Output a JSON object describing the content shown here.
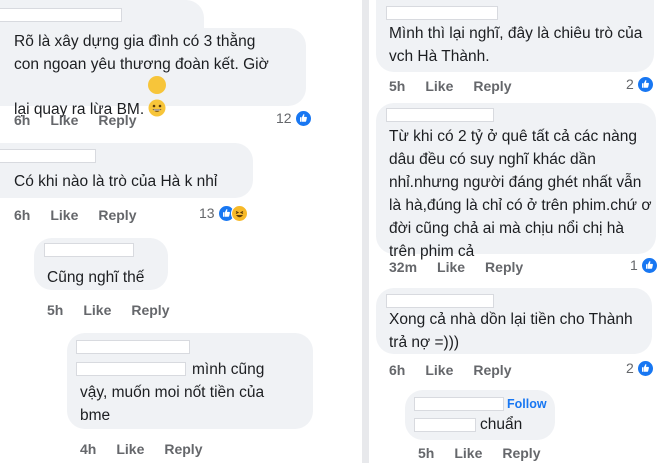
{
  "colors": {
    "bubble": "#f0f2f5",
    "meta_text": "#65676b",
    "like_blue": "#1877f2",
    "haha_yellow": "#f7b928",
    "divider": "#e8e9ec"
  },
  "left": {
    "c1": {
      "text": "Rõ là xây dựng gia đình có 3 thằng\ncon ngoan yêu thương đoàn kết. Giờ\nlại quay ra lừa BM.",
      "time": "6h",
      "like": "Like",
      "reply": "Reply",
      "count": "12",
      "emoji": "grinning-face-icon",
      "reactions": [
        "like-icon"
      ]
    },
    "c2": {
      "text": "Có khi nào là trò của Hà k nhỉ",
      "time": "6h",
      "like": "Like",
      "reply": "Reply",
      "count": "13",
      "reactions": [
        "like-icon",
        "haha-icon"
      ]
    },
    "c3": {
      "text": "Cũng nghĩ thế",
      "time": "5h",
      "like": "Like",
      "reply": "Reply"
    },
    "c4": {
      "text_first": "mình cũng",
      "text_rest": "vậy, muốn moi nốt tiền của\nbme",
      "time": "4h",
      "like": "Like",
      "reply": "Reply"
    }
  },
  "right": {
    "c1": {
      "text": "Mình thì lại nghĩ, đây là chiêu trò của\nvch Hà Thành.",
      "time": "5h",
      "like": "Like",
      "reply": "Reply",
      "count": "2",
      "reactions": [
        "like-icon"
      ]
    },
    "c2": {
      "text": "Từ khi có 2 tỷ ở quê tất cả các nàng\ndâu đều có suy nghĩ khác dần\nnhỉ.nhưng người đáng ghét nhất vẫn\nlà hà,đúng là chỉ có ở trên phim.chứ ơ\nđời cũng chả ai mà chịu nổi chị hà\ntrên phim cả",
      "time": "32m",
      "like": "Like",
      "reply": "Reply",
      "count": "1",
      "reactions": [
        "like-icon"
      ]
    },
    "c3": {
      "text": "Xong cả nhà dồn lại tiền cho Thành\ntrả nợ =)))",
      "time": "6h",
      "like": "Like",
      "reply": "Reply",
      "count": "2",
      "reactions": [
        "like-icon"
      ]
    },
    "c4": {
      "follow": "Follow",
      "text": "chuẩn",
      "time": "5h",
      "like": "Like",
      "reply": "Reply"
    }
  }
}
